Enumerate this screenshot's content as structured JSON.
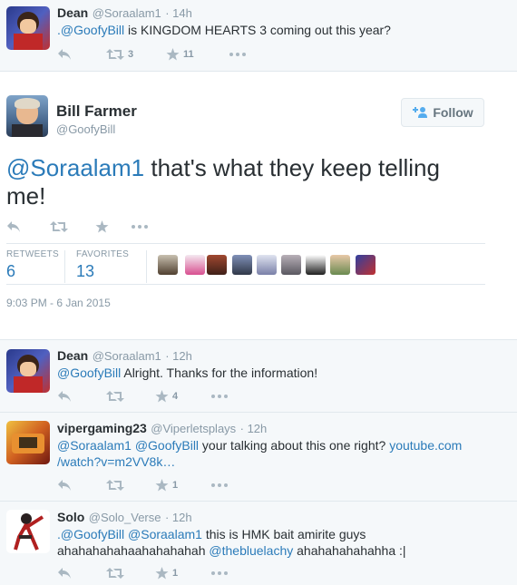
{
  "tweet1": {
    "name": "Dean",
    "handle": "@Soraalam1",
    "time": "· 14h",
    "mention": ".@GoofyBill",
    "text": " is KINGDOM HEARTS 3 coming out this year?",
    "retweets": "3",
    "favorites": "11"
  },
  "main": {
    "name": "Bill Farmer",
    "handle": "@GoofyBill",
    "follow_label": "Follow",
    "mention": "@Soraalam1",
    "text": " that's what they keep telling me!",
    "retweets_label": "RETWEETS",
    "retweets": "6",
    "favorites_label": "FAVORITES",
    "favorites": "13",
    "timestamp": "9:03 PM - 6 Jan 2015"
  },
  "replies": [
    {
      "name": "Dean",
      "handle": "@Soraalam1",
      "time": "· 12h",
      "mention": "@GoofyBill",
      "text": " Alright. Thanks for the information!",
      "retweets": "",
      "favorites": "4"
    },
    {
      "name": "vipergaming23",
      "handle": "@Viperletsplays",
      "time": "· 12h",
      "mention1": "@Soraalam1",
      "mention2": "@GoofyBill",
      "text": " your talking about this one right? ",
      "link": "youtube.com",
      "link2": "/watch?v=m2VV8k…",
      "retweets": "",
      "favorites": "1"
    },
    {
      "name": "Solo",
      "handle": "@Solo_Verse",
      "time": "· 12h",
      "mention1": ".@GoofyBill",
      "mention2": "@Soraalam1",
      "text": " this is HMK bait amirite guys",
      "line2": "ahahahahahaahahahahah ",
      "mention3": "@thebluelachy",
      "text2": " ahahahahahahha :|",
      "retweets": "",
      "favorites": "1"
    }
  ],
  "colors": {
    "link": "#2b7bb9",
    "muted": "#8899a6",
    "icon": "#aab8c2",
    "reply_bg": "#f5f8fa",
    "divider": "#e1e8ed"
  },
  "icons": [
    "reply-icon",
    "retweet-icon",
    "favorite-icon",
    "more-icon",
    "follow-user-icon"
  ]
}
